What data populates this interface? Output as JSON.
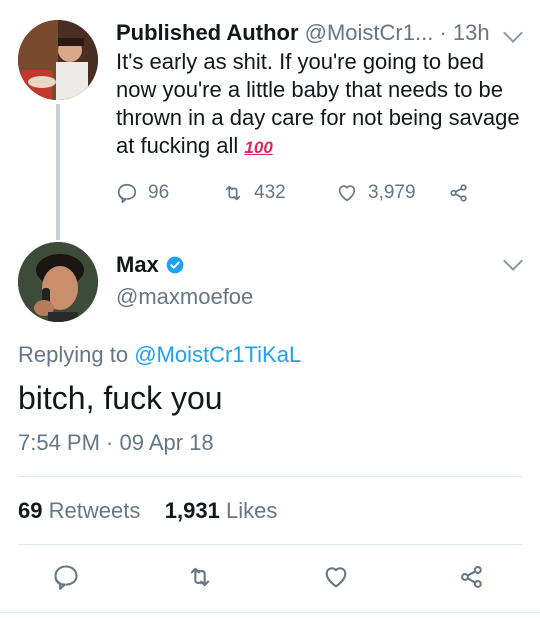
{
  "parent_tweet": {
    "author_name": "Published Author",
    "handle": "@MoistCr1...",
    "separator": "·",
    "time": "13h",
    "text": "It's early as shit. If you're going to bed now you're a little baby that needs to be thrown in a day care for not being savage at fucking all",
    "emoji": "100",
    "replies": "96",
    "retweets": "432",
    "likes": "3,979"
  },
  "main_tweet": {
    "author_name": "Max",
    "handle": "@maxmoefoe",
    "replying_prefix": "Replying to",
    "replying_to": "@MoistCr1TiKaL",
    "text": "bitch, fuck you",
    "timestamp": "7:54 PM · 09 Apr 18",
    "retweet_count": "69",
    "retweet_label": "Retweets",
    "like_count": "1,931",
    "like_label": "Likes"
  },
  "colors": {
    "link": "#1da1f2",
    "secondary_text": "#657786",
    "thread_line": "#c4cfd6",
    "verified": "#1da1f2"
  }
}
